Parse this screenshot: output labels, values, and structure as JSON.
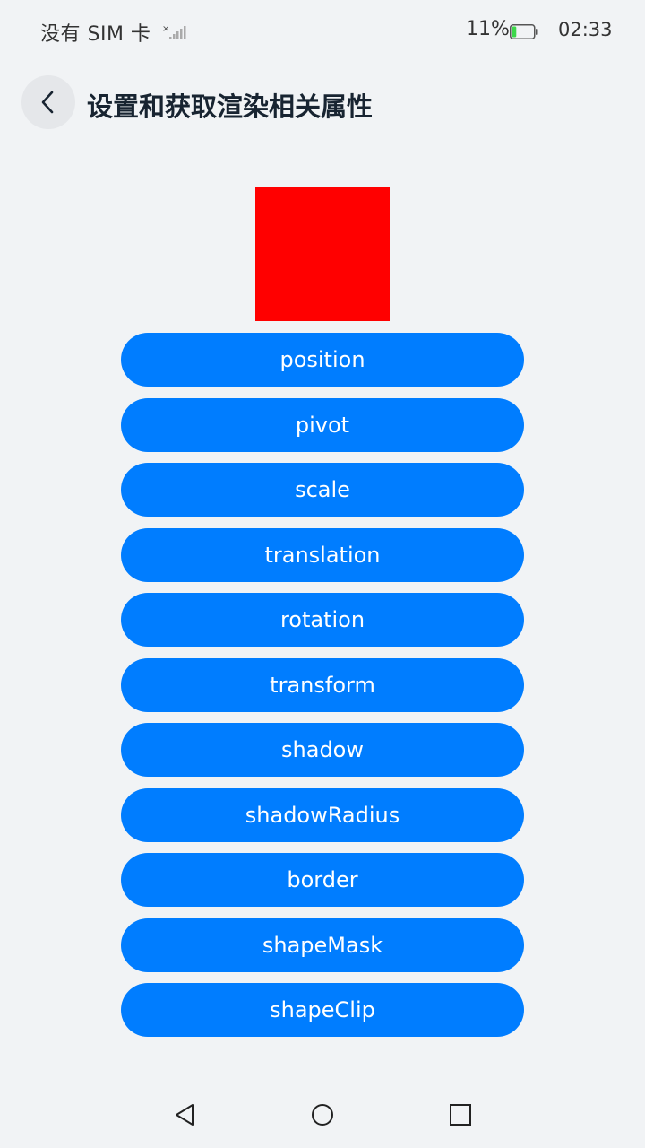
{
  "status_bar": {
    "carrier": "没有 SIM 卡",
    "battery_percent": "11%",
    "battery_level": 0.11,
    "time": "02:33",
    "icons": [
      "signal-icon",
      "battery-icon"
    ]
  },
  "header": {
    "title": "设置和获取渲染相关属性",
    "back_icon": "chevron-left-icon"
  },
  "preview": {
    "color": "#ff0000"
  },
  "buttons": [
    {
      "label": "position"
    },
    {
      "label": "pivot"
    },
    {
      "label": "scale"
    },
    {
      "label": "translation"
    },
    {
      "label": "rotation"
    },
    {
      "label": "transform"
    },
    {
      "label": "shadow"
    },
    {
      "label": "shadowRadius"
    },
    {
      "label": "border"
    },
    {
      "label": "shapeMask"
    },
    {
      "label": "shapeClip"
    }
  ],
  "nav_bar": {
    "icons": [
      "back-triangle-icon",
      "home-circle-icon",
      "recents-square-icon"
    ]
  },
  "colors": {
    "accent": "#007dff",
    "background": "#f1f3f5",
    "battery_fill": "#3cd74a"
  }
}
